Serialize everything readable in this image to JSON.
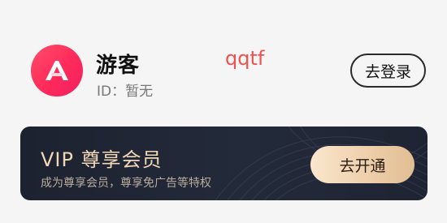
{
  "profile": {
    "name": "游客",
    "id_text": "ID：暂无",
    "watermark": "qqtf",
    "login_label": "去登录",
    "avatar_icon": "app-logo-icon",
    "avatar_color": "#ff2f5f"
  },
  "vip": {
    "title": "VIP 尊享会员",
    "subtitle": "成为尊享会员，尊享免广告等特权",
    "button_label": "去开通",
    "accent_color": "#e8c49c",
    "card_color": "#1f2433"
  }
}
